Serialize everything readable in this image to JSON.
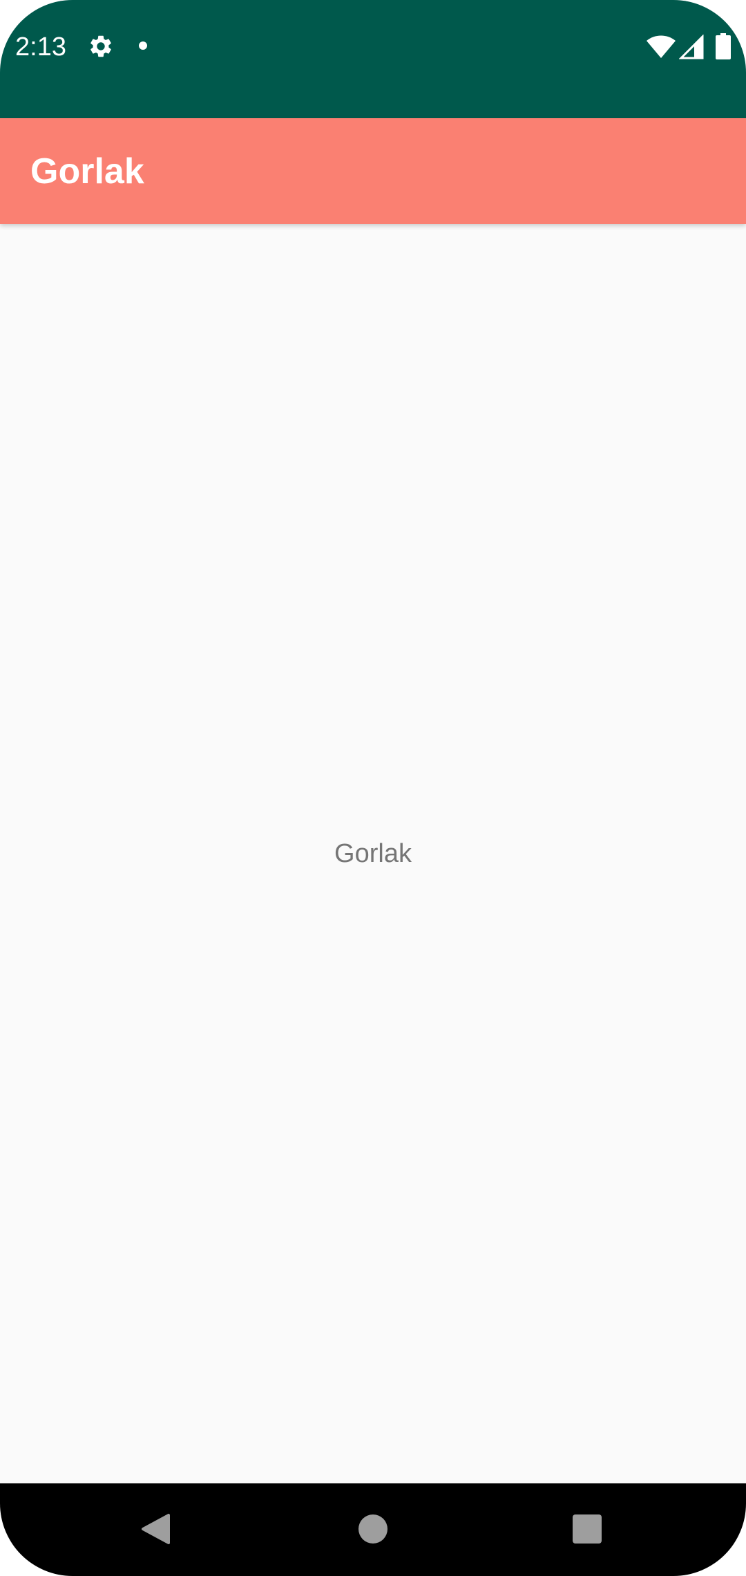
{
  "status_bar": {
    "time": "2:13",
    "icons": [
      "gear-icon",
      "notification-dot-icon",
      "wifi-icon",
      "signal-icon",
      "battery-icon"
    ],
    "background_color": "#00594c"
  },
  "app_bar": {
    "title": "Gorlak",
    "background_color": "#fa8072"
  },
  "content": {
    "center_text": "Gorlak"
  },
  "navigation_bar": {
    "buttons": [
      "back-icon",
      "home-icon",
      "recents-icon"
    ]
  }
}
